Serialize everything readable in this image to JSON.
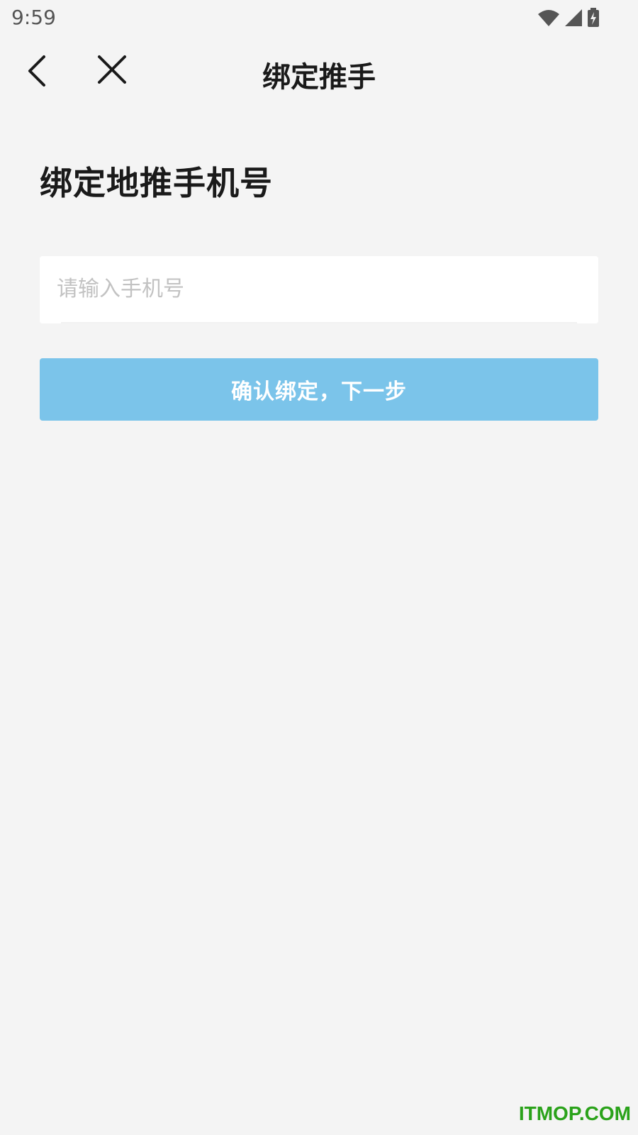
{
  "status_bar": {
    "time": "9:59"
  },
  "nav": {
    "title": "绑定推手"
  },
  "heading": "绑定地推手机号",
  "phone_input": {
    "placeholder": "请输入手机号",
    "value": ""
  },
  "confirm_button": {
    "label": "确认绑定，下一步"
  },
  "watermark": "ITMOP.COM",
  "colors": {
    "background": "#f4f4f4",
    "button": "#7bc4ea",
    "watermark": "#2aa21a"
  }
}
